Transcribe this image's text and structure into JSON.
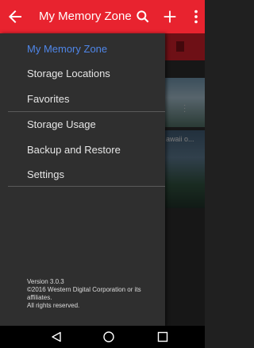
{
  "app_bar": {
    "title": "My Memory Zone",
    "background_color": "#e8232f",
    "back_icon": "arrow-left-icon",
    "actions": [
      "search-icon",
      "plus-icon",
      "more-vertical-icon"
    ]
  },
  "drawer": {
    "items_group1": [
      {
        "label": "My Memory Zone",
        "active": true
      },
      {
        "label": "Storage Locations",
        "active": false
      },
      {
        "label": "Favorites",
        "active": false
      }
    ],
    "items_group2": [
      {
        "label": "Storage Usage",
        "active": false
      },
      {
        "label": "Backup and Restore",
        "active": false
      },
      {
        "label": "Settings",
        "active": false
      }
    ],
    "active_color": "#4f86e8",
    "footer": {
      "version": "Version 3.0.3",
      "copyright": "©2016 Western Digital Corporation or its affiliates.",
      "rights": "All rights reserved."
    }
  },
  "background_content": {
    "photo_caption": "awaii o..."
  },
  "system_nav": {
    "buttons": [
      "back-triangle-icon",
      "home-circle-icon",
      "recents-square-icon"
    ]
  }
}
